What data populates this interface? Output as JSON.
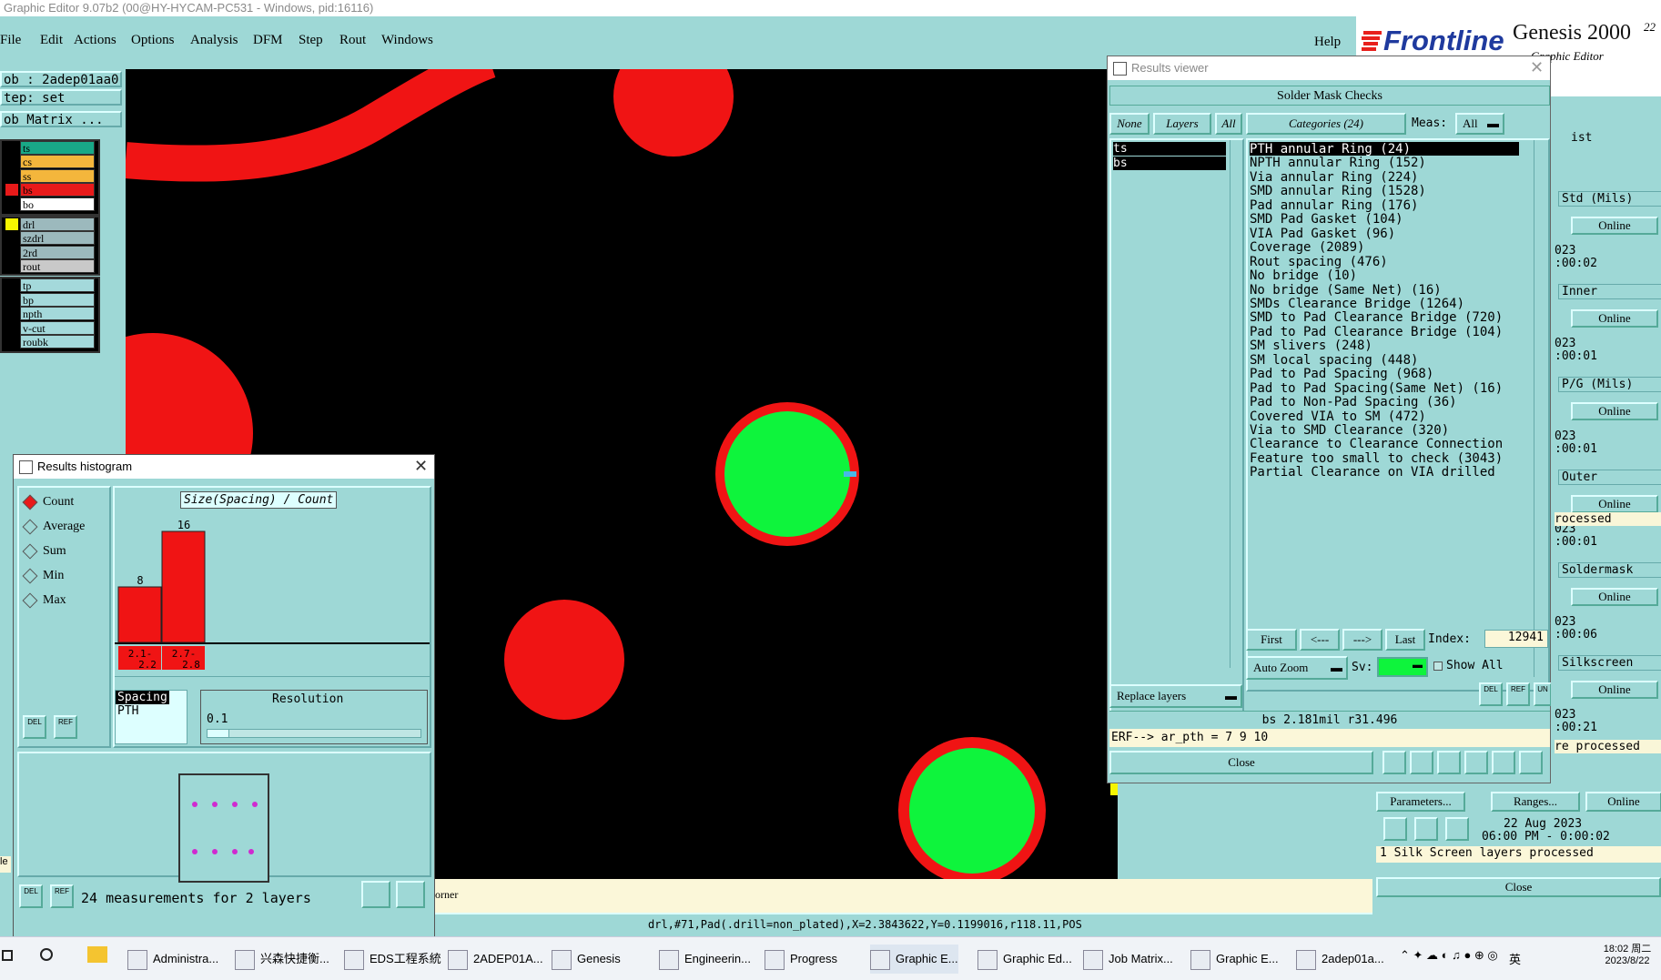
{
  "window": {
    "title": "Graphic Editor 9.07b2 (00@HY-HYCAM-PC531 - Windows, pid:16116)"
  },
  "menu": {
    "items": [
      "File",
      "Edit",
      "Actions",
      "Options",
      "Analysis",
      "DFM",
      "Step",
      "Rout",
      "Windows"
    ],
    "help": "Help"
  },
  "brand": {
    "logo": "Frontline",
    "product": "Genesis 2000",
    "version": "22",
    "subtitle": "Graphic Editor"
  },
  "left_panel": {
    "job": "ob : 2adep01aa0",
    "step": "tep: set",
    "job_matrix": "ob Matrix ...",
    "layers_group1": [
      {
        "name": "ts",
        "color": "#19a887"
      },
      {
        "name": "cs",
        "color": "#f4b63c"
      },
      {
        "name": "ss",
        "color": "#f4b63c"
      },
      {
        "name": "bs",
        "color": "#e81a1a"
      },
      {
        "name": "bo",
        "color": "#ffffff"
      }
    ],
    "layers_group2": [
      {
        "name": "drl",
        "color": "#9cb9bd"
      },
      {
        "name": "szdrl",
        "color": "#9cb9bd"
      },
      {
        "name": "2rd",
        "color": "#9cb9bd"
      },
      {
        "name": "rout",
        "color": "#c9c9c9"
      }
    ],
    "layers_group3": [
      {
        "name": "tp",
        "color": "#a4d9db"
      },
      {
        "name": "bp",
        "color": "#a4d9db"
      },
      {
        "name": "npth",
        "color": "#a4d9db"
      },
      {
        "name": "v-cut",
        "color": "#a4d9db"
      },
      {
        "name": "roubk",
        "color": "#a4d9db"
      }
    ],
    "bottom_label": "le"
  },
  "histogram": {
    "title": "Results histogram",
    "modes": [
      "Count",
      "Average",
      "Sum",
      "Min",
      "Max"
    ],
    "selected_mode": "Count",
    "chart_label": "Size(Spacing) / Count",
    "bars": [
      {
        "value": 8,
        "range_low": "2.1-",
        "range_high": "2.2"
      },
      {
        "value": 16,
        "range_low": "2.7-",
        "range_high": "2.8"
      }
    ],
    "attr_list": [
      "Spacing",
      "PTH"
    ],
    "resolution_label": "Resolution",
    "resolution_value": "0.1",
    "icon_btn1": "DEL",
    "icon_btn2": "REF",
    "status": "24 measurements for 2 layers"
  },
  "results_viewer": {
    "title": "Results viewer",
    "header": "Solder Mask Checks",
    "none_btn": "None",
    "layers_btn": "Layers",
    "all_btn": "All",
    "categories_btn": "Categories (24)",
    "meas_label": "Meas:",
    "meas_value": "All",
    "layers": [
      "ts",
      "bs"
    ],
    "categories": [
      "PTH annular Ring (24)",
      "NPTH annular Ring (152)",
      "Via annular Ring (224)",
      "SMD annular Ring (1528)",
      "Pad annular Ring (176)",
      "SMD Pad Gasket (104)",
      "VIA Pad Gasket (96)",
      "Coverage (2089)",
      "Rout spacing (476)",
      "No bridge (10)",
      "No bridge (Same Net) (16)",
      "SMDs Clearance Bridge (1264)",
      "SMD to Pad Clearance Bridge (720)",
      "Pad to Pad Clearance Bridge (104)",
      "SM slivers (248)",
      "SM local spacing (448)",
      "Pad to Pad Spacing (968)",
      "Pad to Pad Spacing(Same Net) (16)",
      "Pad to Non-Pad Spacing (36)",
      "Covered VIA to SM (472)",
      "Via to SMD Clearance (320)",
      "Clearance to Clearance Connection",
      "Feature too small to check (3043)",
      "Partial Clearance on VIA drilled"
    ],
    "nav": {
      "first": "First",
      "prev": "<---",
      "next": "--->",
      "last": "Last",
      "index_label": "Index:",
      "index_value": "12941"
    },
    "auto_zoom": "Auto Zoom",
    "sv_label": "Sv:",
    "show_all": "Show All",
    "replace_layers": "Replace layers",
    "info_line": "bs 2.181mil  r31.496",
    "erf_line": "ERF--> ar_pth = 7 9 10",
    "close": "Close"
  },
  "right_panel": {
    "top_text": "ist",
    "online": "Online",
    "date_fragments": [
      "023",
      ":00:02",
      "023",
      ":00:01",
      "023",
      ":00:01",
      "023",
      ":00:01",
      "023",
      ":00:06",
      "023",
      ":00:21"
    ],
    "labels": [
      "Std (Mils)",
      "Inner",
      "P/G (Mils)",
      "Outer",
      "Soldermask",
      "Silkscreen"
    ],
    "processed1": "rocessed",
    "processed2": "re processed",
    "parameters_btn": "Parameters...",
    "ranges_btn": "Ranges...",
    "date_line1": "22 Aug 2023",
    "date_line2": "06:00 PM - 0:00:02",
    "silk_status": "1 Silk Screen layers processed",
    "close": "Close"
  },
  "status_line": {
    "coord_fragment": "orner",
    "feature_info": "drl,#71,Pad(.drill=non_plated),X=2.3843622,Y=0.1199016,r118.11,POS"
  },
  "taskbar": {
    "items": [
      "Administra...",
      "兴森快捷衡...",
      "EDS工程系統",
      "2ADEP01A...",
      "Genesis",
      "Engineerin...",
      "Progress",
      "Graphic E...",
      "Graphic Ed...",
      "Job Matrix...",
      "Graphic E...",
      "2adep01a..."
    ],
    "ime": "英",
    "clock_time": "18:02 周二",
    "clock_date": "2023/8/22"
  }
}
